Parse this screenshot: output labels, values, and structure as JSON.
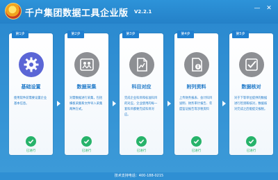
{
  "app": {
    "title": "千户集团数据工具企业版",
    "version": "V2.2.1"
  },
  "window": {
    "minimize_icon": "minimize-icon",
    "close_icon": "close-icon"
  },
  "steps": [
    {
      "tab": "第1步",
      "title": "基础设置",
      "desc": "使用软件前需要设置企业基本信息。",
      "status": "已进行",
      "icon": "gear-icon"
    },
    {
      "tab": "第2步",
      "title": "数据采集",
      "desc": "对需数据进行采集，包括横板采集和文件导入采集两种方式。",
      "status": "已进行",
      "icon": "transfer-icon"
    },
    {
      "tab": "第3步",
      "title": "科目对应",
      "desc": "完成企业科目和标准科目的对应，企业使用的每一套科目都要完成科目对应。",
      "status": "已进行",
      "icon": "document-chart-icon"
    },
    {
      "tab": "第4步",
      "title": "附列资料",
      "desc": "上传财务报表、会计科目说明、财务审计报告、年度鉴证报告等涉税资料",
      "status": "已进行",
      "icon": "file-info-icon"
    },
    {
      "tab": "第5步",
      "title": "数据核对",
      "desc": "对于下等单位提供的数据进行检测和核对，数据核对完成之后能提交报税。",
      "status": "已进行",
      "icon": "checkbox-icon"
    }
  ],
  "footer": {
    "support": "技术支持电话：400-188-0215"
  },
  "colors": {
    "primary": "#1f7fd0",
    "success": "#27b36a",
    "background": "#2f8fd3"
  }
}
